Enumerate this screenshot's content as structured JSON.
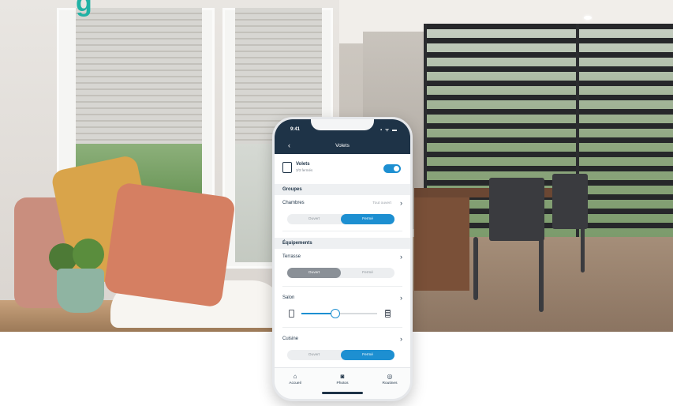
{
  "phone": {
    "status_time": "9:41",
    "status_icons": "▪︎ ᯤ ▬",
    "back_glyph": "‹",
    "screen_title": "Volets",
    "main_device": {
      "name": "Volets",
      "subtitle": "3/3 fermés",
      "toggle_on": true
    },
    "groups_heading": "Groupes",
    "groups": [
      {
        "name": "Chambres",
        "state": "Tout ouvert",
        "options": [
          "Ouvert",
          "Fermé"
        ],
        "selected": 1
      }
    ],
    "devices_heading": "Équipements",
    "devices": [
      {
        "name": "Terrasse",
        "options": [
          "Ouvert",
          "Fermé"
        ],
        "selected": 0
      },
      {
        "name": "Salon",
        "slider_level_percent": 45
      },
      {
        "name": "Cuisine",
        "options": [
          "Ouvert",
          "Fermé"
        ],
        "selected": 1
      }
    ],
    "tabs": [
      {
        "label": "Accueil",
        "icon": "home-icon",
        "glyph": "⌂"
      },
      {
        "label": "Photos",
        "icon": "camera-icon",
        "glyph": "◙"
      },
      {
        "label": "Routines",
        "icon": "routines-icon",
        "glyph": "◎"
      }
    ]
  },
  "logo_fragment": "g",
  "colors": {
    "header": "#1e3347",
    "accent": "#1d8fd1",
    "selected_grey": "#8a9097",
    "brand_teal": "#21b2a5"
  }
}
